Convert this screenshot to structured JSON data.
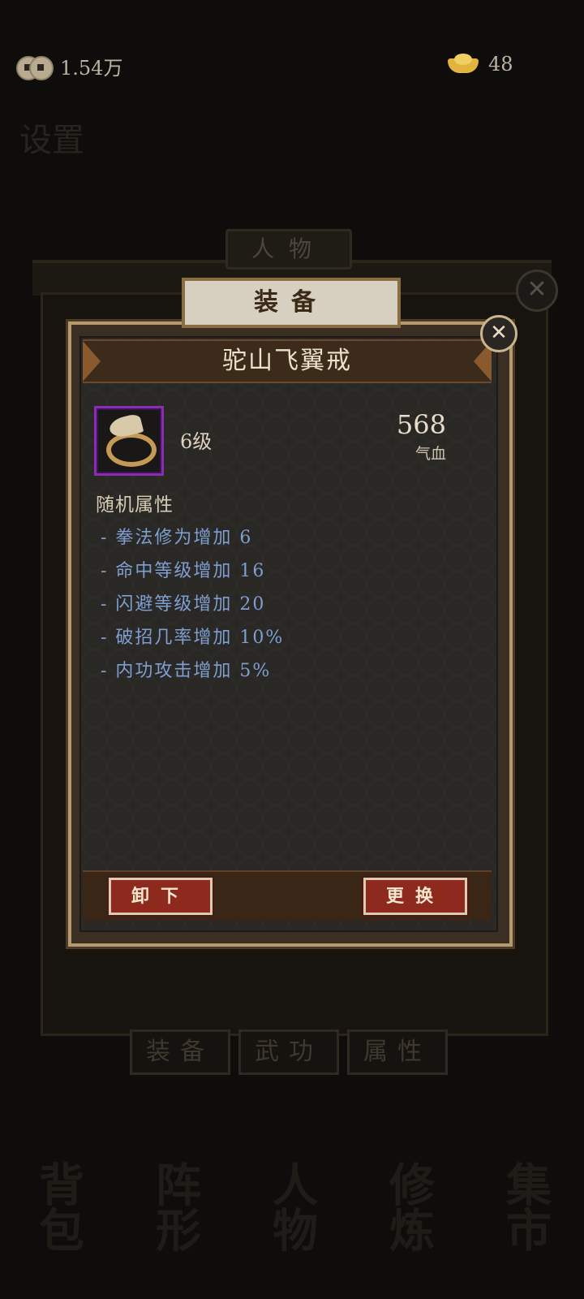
{
  "currency": {
    "coins": "1.54万",
    "coin_icon": "coin-icon",
    "ingots": "48",
    "ingot_icon": "gold-ingot-icon"
  },
  "background": {
    "top_tab": "人物",
    "bottom_tabs": [
      "装备",
      "武功",
      "属性"
    ],
    "bottom_nav": [
      "背包",
      "阵形",
      "人物",
      "修炼",
      "集市"
    ]
  },
  "dialog": {
    "header": "装备",
    "item_name": "驼山飞翼戒",
    "item_icon": "winged-ring-icon",
    "level": "6级",
    "stat_value": "568",
    "stat_label": "气血",
    "random_attr_title": "随机属性",
    "random_attrs": [
      "- 拳法修为增加 6",
      "- 命中等级增加 16",
      "- 闪避等级增加 20",
      "- 破招几率增加 10%",
      "- 内功攻击增加 5%"
    ],
    "unequip_label": "卸下",
    "replace_label": "更换"
  },
  "colors": {
    "attr_text": "#7f9ed2",
    "button_red": "#8e2a1d",
    "rarity_purple": "#8a2db2"
  }
}
